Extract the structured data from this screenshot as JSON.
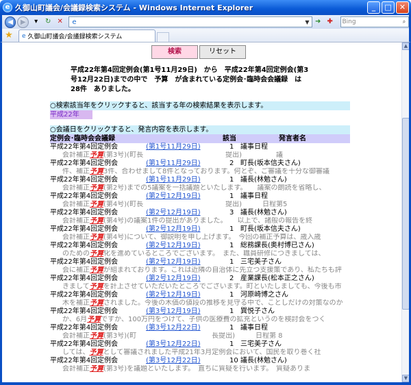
{
  "window": {
    "title": "久御山町議会/会議録検索システム - Windows Internet Explorer",
    "tab_title": "久御山町議会/会議録検索システム",
    "search_placeholder": "Bing"
  },
  "controls": {
    "search_label": "検索",
    "reset_label": "リセット"
  },
  "summary": {
    "line1": "平成22年第4回定例会(第1号11月29日)　から　平成22年第4回定例会(第3",
    "line2": "号12月22日)までの中で　予算　が含まれている定例会･臨時会会議録　は",
    "line3": "28件　ありました。"
  },
  "hints": {
    "year_hint": "○検索該当年をクリックすると、該当する年の検索結果を表示します。",
    "year_link": "平成22年",
    "date_hint": "○会議日をクリックすると、発言内容を表示します。"
  },
  "table": {
    "col_meeting": "定例会･臨時会会議録",
    "col_match": "該当",
    "col_speaker": "発言者名"
  },
  "colors": {
    "highlight": "#e02020",
    "link": "#2255d0",
    "hint_bg": "#cdeffa",
    "header_bg": "#d0ccfa"
  },
  "rows": [
    {
      "meeting": "平成22年第4回定例会",
      "date": "(第1号11月29日)",
      "num": "1",
      "speaker": "議事日程",
      "pre": "会計補正",
      "kw": "予算",
      "post": "(第3号)(町長　　　　　　　　　　　　提出)　　　　　議"
    },
    {
      "meeting": "平成22年第4回定例会",
      "date": "(第1号11月29日)",
      "num": "2",
      "speaker": "町長(坂本信夫さん)",
      "pre": "件、補正",
      "kw": "予算",
      "post": "3件、合わせまして8件となっております。何とぞ、ご審議を十分な御審議"
    },
    {
      "meeting": "平成22年第4回定例会",
      "date": "(第1号11月29日)",
      "num": "1",
      "speaker": "議長(林勉さん)",
      "pre": "会計補正",
      "kw": "予算",
      "post": "(第2号)までの5議案を一括議題といたします。　　議案の朗読を省略し、"
    },
    {
      "meeting": "平成22年第4回定例会",
      "date": "(第2号12月19日)",
      "num": "1",
      "speaker": "議事日程",
      "pre": "会計補正",
      "kw": "予算",
      "post": "(第4号)(町長　　　　　　　　　　　　提出)　　　日程第5"
    },
    {
      "meeting": "平成22年第4回定例会",
      "date": "(第2号12月19日)",
      "num": "3",
      "speaker": "議長(林勉さん)",
      "pre": "会計補正",
      "kw": "予算",
      "post": "(第4号)の議案1件の提出がありました。　　以上で、諸般の報告を終"
    },
    {
      "meeting": "平成22年第4回定例会",
      "date": "(第2号12月19日)",
      "num": "1",
      "speaker": "町長(坂本信夫さん)",
      "pre": "会計補正",
      "kw": "予算",
      "post": "(第4号)について、御説明を申し上げます。　今回の補正予算は、歳入歳"
    },
    {
      "meeting": "平成22年第4回定例会",
      "date": "(第2号12月19日)",
      "num": "1",
      "speaker": "総務課長(奥村博已さん)",
      "pre": "のための",
      "kw": "予算",
      "post": "化を進めているところでございます。　また、職員研修につきましては、"
    },
    {
      "meeting": "平成22年第4回定例会",
      "date": "(第2号12月19日)",
      "num": "1",
      "speaker": "三宅美子さん",
      "pre": "会に補正",
      "kw": "予算",
      "post": "が組まれております。これは近隣の自治体に先立つ支援策であり、私たちも評"
    },
    {
      "meeting": "平成22年第4回定例会",
      "date": "(第2号12月19日)",
      "num": "2",
      "speaker": "産業課長(松本正之さん)",
      "pre": "きまして",
      "kw": "予算",
      "post": "を計上させていただいたところでございます。町といたしましても、今後も市"
    },
    {
      "meeting": "平成22年第4回定例会",
      "date": "(第2号12月19日)",
      "num": "1",
      "speaker": "河原崎博之さん",
      "pre": "木を補正",
      "kw": "予算",
      "post": "されました。今後の木価の値段の推移を見守る中で、ことしだけの対策なのか"
    },
    {
      "meeting": "平成22年第4回定例会",
      "date": "(第3号12月19日)",
      "num": "1",
      "speaker": "巽悦子さん",
      "pre": "か、6月",
      "kw": "予算",
      "post": "ですか、100万円をつけて、子供の医療費の拡充というのを検討会をつく"
    },
    {
      "meeting": "平成22年第4回定例会",
      "date": "(第3号12月22日)",
      "num": "1",
      "speaker": "議事日程",
      "pre": "会計補正",
      "kw": "予算",
      "post": "(第3号)(町　　　　　　　　　　　長提出)　　　日程第 8"
    },
    {
      "meeting": "平成22年第4回定例会",
      "date": "(第3号12月22日)",
      "num": "1",
      "speaker": "三宅美子さん",
      "pre": "しては、",
      "kw": "予算",
      "post": "として審議されました平成21年3月定例会において、国民を取り巻く社"
    },
    {
      "meeting": "平成22年第4回定例会",
      "date": "(第3号12月22日)",
      "num": "10",
      "speaker": "議長(林勉さん)",
      "pre": "会計補正",
      "kw": "予算",
      "post": "(第3号)を議題といたします。　直ちに質疑を行います。　質疑ありま"
    }
  ]
}
